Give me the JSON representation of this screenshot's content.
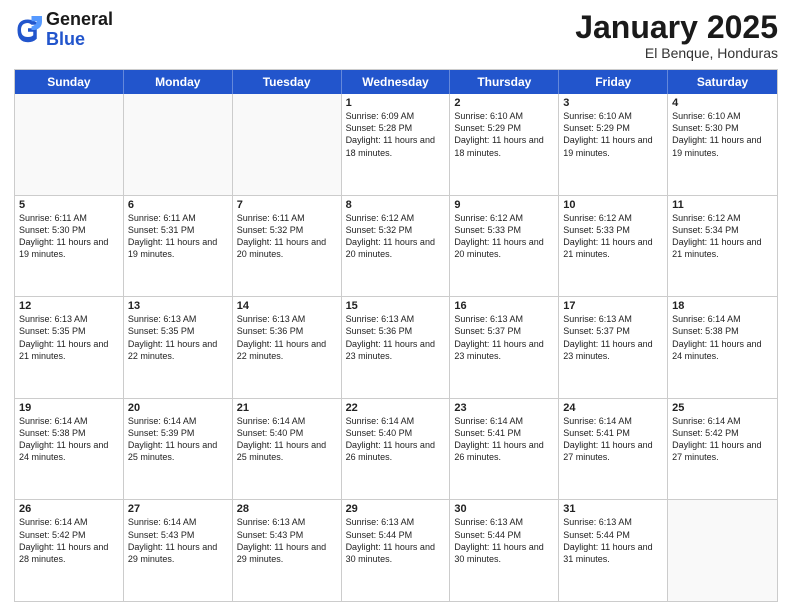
{
  "logo": {
    "text_general": "General",
    "text_blue": "Blue"
  },
  "title": "January 2025",
  "subtitle": "El Benque, Honduras",
  "days_of_week": [
    "Sunday",
    "Monday",
    "Tuesday",
    "Wednesday",
    "Thursday",
    "Friday",
    "Saturday"
  ],
  "weeks": [
    [
      {
        "day": "",
        "info": ""
      },
      {
        "day": "",
        "info": ""
      },
      {
        "day": "",
        "info": ""
      },
      {
        "day": "1",
        "info": "Sunrise: 6:09 AM\nSunset: 5:28 PM\nDaylight: 11 hours and 18 minutes."
      },
      {
        "day": "2",
        "info": "Sunrise: 6:10 AM\nSunset: 5:29 PM\nDaylight: 11 hours and 18 minutes."
      },
      {
        "day": "3",
        "info": "Sunrise: 6:10 AM\nSunset: 5:29 PM\nDaylight: 11 hours and 19 minutes."
      },
      {
        "day": "4",
        "info": "Sunrise: 6:10 AM\nSunset: 5:30 PM\nDaylight: 11 hours and 19 minutes."
      }
    ],
    [
      {
        "day": "5",
        "info": "Sunrise: 6:11 AM\nSunset: 5:30 PM\nDaylight: 11 hours and 19 minutes."
      },
      {
        "day": "6",
        "info": "Sunrise: 6:11 AM\nSunset: 5:31 PM\nDaylight: 11 hours and 19 minutes."
      },
      {
        "day": "7",
        "info": "Sunrise: 6:11 AM\nSunset: 5:32 PM\nDaylight: 11 hours and 20 minutes."
      },
      {
        "day": "8",
        "info": "Sunrise: 6:12 AM\nSunset: 5:32 PM\nDaylight: 11 hours and 20 minutes."
      },
      {
        "day": "9",
        "info": "Sunrise: 6:12 AM\nSunset: 5:33 PM\nDaylight: 11 hours and 20 minutes."
      },
      {
        "day": "10",
        "info": "Sunrise: 6:12 AM\nSunset: 5:33 PM\nDaylight: 11 hours and 21 minutes."
      },
      {
        "day": "11",
        "info": "Sunrise: 6:12 AM\nSunset: 5:34 PM\nDaylight: 11 hours and 21 minutes."
      }
    ],
    [
      {
        "day": "12",
        "info": "Sunrise: 6:13 AM\nSunset: 5:35 PM\nDaylight: 11 hours and 21 minutes."
      },
      {
        "day": "13",
        "info": "Sunrise: 6:13 AM\nSunset: 5:35 PM\nDaylight: 11 hours and 22 minutes."
      },
      {
        "day": "14",
        "info": "Sunrise: 6:13 AM\nSunset: 5:36 PM\nDaylight: 11 hours and 22 minutes."
      },
      {
        "day": "15",
        "info": "Sunrise: 6:13 AM\nSunset: 5:36 PM\nDaylight: 11 hours and 23 minutes."
      },
      {
        "day": "16",
        "info": "Sunrise: 6:13 AM\nSunset: 5:37 PM\nDaylight: 11 hours and 23 minutes."
      },
      {
        "day": "17",
        "info": "Sunrise: 6:13 AM\nSunset: 5:37 PM\nDaylight: 11 hours and 23 minutes."
      },
      {
        "day": "18",
        "info": "Sunrise: 6:14 AM\nSunset: 5:38 PM\nDaylight: 11 hours and 24 minutes."
      }
    ],
    [
      {
        "day": "19",
        "info": "Sunrise: 6:14 AM\nSunset: 5:38 PM\nDaylight: 11 hours and 24 minutes."
      },
      {
        "day": "20",
        "info": "Sunrise: 6:14 AM\nSunset: 5:39 PM\nDaylight: 11 hours and 25 minutes."
      },
      {
        "day": "21",
        "info": "Sunrise: 6:14 AM\nSunset: 5:40 PM\nDaylight: 11 hours and 25 minutes."
      },
      {
        "day": "22",
        "info": "Sunrise: 6:14 AM\nSunset: 5:40 PM\nDaylight: 11 hours and 26 minutes."
      },
      {
        "day": "23",
        "info": "Sunrise: 6:14 AM\nSunset: 5:41 PM\nDaylight: 11 hours and 26 minutes."
      },
      {
        "day": "24",
        "info": "Sunrise: 6:14 AM\nSunset: 5:41 PM\nDaylight: 11 hours and 27 minutes."
      },
      {
        "day": "25",
        "info": "Sunrise: 6:14 AM\nSunset: 5:42 PM\nDaylight: 11 hours and 27 minutes."
      }
    ],
    [
      {
        "day": "26",
        "info": "Sunrise: 6:14 AM\nSunset: 5:42 PM\nDaylight: 11 hours and 28 minutes."
      },
      {
        "day": "27",
        "info": "Sunrise: 6:14 AM\nSunset: 5:43 PM\nDaylight: 11 hours and 29 minutes."
      },
      {
        "day": "28",
        "info": "Sunrise: 6:13 AM\nSunset: 5:43 PM\nDaylight: 11 hours and 29 minutes."
      },
      {
        "day": "29",
        "info": "Sunrise: 6:13 AM\nSunset: 5:44 PM\nDaylight: 11 hours and 30 minutes."
      },
      {
        "day": "30",
        "info": "Sunrise: 6:13 AM\nSunset: 5:44 PM\nDaylight: 11 hours and 30 minutes."
      },
      {
        "day": "31",
        "info": "Sunrise: 6:13 AM\nSunset: 5:44 PM\nDaylight: 11 hours and 31 minutes."
      },
      {
        "day": "",
        "info": ""
      }
    ]
  ]
}
